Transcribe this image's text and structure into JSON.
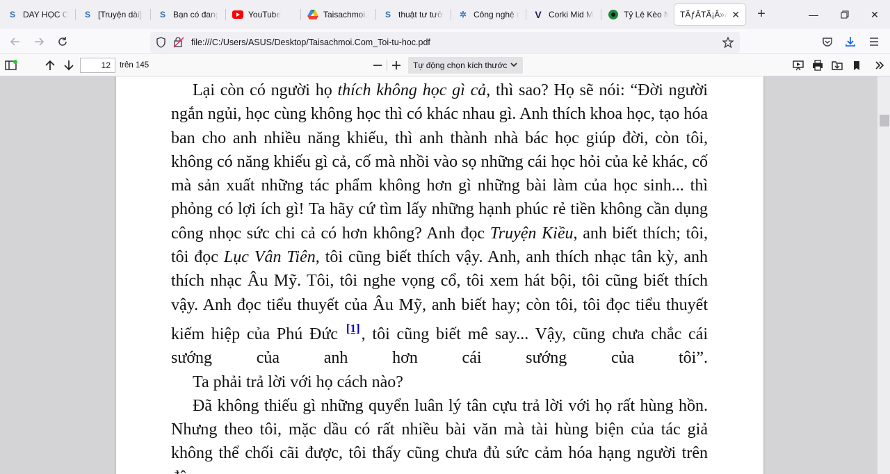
{
  "tabs": [
    {
      "label": "DAY HỌC ON",
      "icon": "s-site-icon"
    },
    {
      "label": "[Truyện dài] N",
      "icon": "s-site-icon"
    },
    {
      "label": "Bạn có đang",
      "icon": "s-site-icon"
    },
    {
      "label": "YouTube",
      "icon": "youtube-icon"
    },
    {
      "label": "Taisachmoi.C",
      "icon": "google-drive-icon"
    },
    {
      "label": "thuật tư tưởn",
      "icon": "s-site-icon"
    },
    {
      "label": "Công nghệ th",
      "icon": "network-icon"
    },
    {
      "label": "Corki Mid Mù",
      "icon": "v-logo-icon"
    },
    {
      "label": "Tỷ Lệ Kèo Nh",
      "icon": "green-circle-icon"
    },
    {
      "label": "TÃƒÂ­TÃ¡Â»Âs",
      "icon": "none",
      "active": true
    }
  ],
  "nav": {
    "url": "file:///C:/Users/ASUS/Desktop/Taisachmoi.Com_Toi-tu-hoc.pdf"
  },
  "pdf_toolbar": {
    "page_number": "12",
    "page_count": "trên 145",
    "zoom": "Tự động chọn kích thước"
  },
  "document": {
    "p1_a": "Lại còn có người họ ",
    "p1_em1": "thích không học gì cả",
    "p1_b": ", thì sao? Họ sẽ nói: “Đời người ngắn ngủi, học cùng không học thì có khác nhau gì. Anh thích khoa học, tạo hóa ban cho anh nhiều năng khiếu, thì anh thành nhà bác học giúp đời, còn tôi, không có năng khiếu gì cả, cố mà nhồi vào sọ những cái học hỏi của kẻ khác, cố mà sản xuất những tác phẩm không hơn gì những bài làm của học sinh... thì phỏng có lợi ích gì! Ta hãy cứ tìm lấy những hạnh phúc rẻ tiền không cần dụng công nhọc sức chi cả có hơn không? Anh đọc ",
    "p1_em2": "Truyện Kiều",
    "p1_c": ", anh biết thích; tôi, tôi đọc ",
    "p1_em3": "Lục Vân Tiên",
    "p1_d": ", tôi cũng biết thích vậy. Anh, anh thích nhạc tân kỳ, anh thích nhạc Âu Mỹ. Tôi, tôi nghe vọng cổ, tôi xem hát bội, tôi cũng biết thích vậy. Anh đọc tiểu thuyết của Âu Mỹ, anh biết hay; còn tôi, tôi đọc tiểu thuyết kiếm hiệp của Phú Đức ",
    "p1_fn": "[1]",
    "p1_e": ", tôi cũng biết mê say... Vậy, cũng chưa chắc cái sướng của anh hơn cái sướng của tôi”.",
    "p2": "Ta phải trả lời với họ cách nào?",
    "p3": "Đã không thiếu gì những quyển luân lý tân cựu trả lời với họ rất hùng hồn. Nhưng theo tôi, mặc dầu có rất nhiều bài văn mà tài hùng biện của tác giả không thể chối cãi được, tôi thấy cũng chưa đủ sức cảm hóa hạng người trên đây."
  }
}
